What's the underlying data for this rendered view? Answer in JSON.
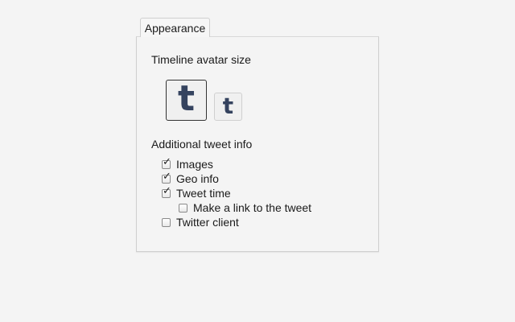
{
  "tabs": [
    {
      "label": "Appearance",
      "active": true
    }
  ],
  "avatar_section": {
    "title": "Timeline avatar size",
    "options": [
      {
        "size": "large",
        "glyph": "t",
        "selected": true,
        "icon": "tumblr-logo-icon"
      },
      {
        "size": "small",
        "glyph": "t",
        "selected": false,
        "icon": "tumblr-logo-icon"
      }
    ]
  },
  "tweet_info_section": {
    "title": "Additional tweet info",
    "options": [
      {
        "label": "Images",
        "checked": true
      },
      {
        "label": "Geo info",
        "checked": true
      },
      {
        "label": "Tweet time",
        "checked": true
      },
      {
        "label": "Make a link to the tweet",
        "checked": false,
        "indented": true
      },
      {
        "label": "Twitter client",
        "checked": false
      }
    ]
  },
  "colors": {
    "background": "#f4f4f4",
    "panel_border": "#cfcfcf",
    "logo": "#35435f"
  }
}
